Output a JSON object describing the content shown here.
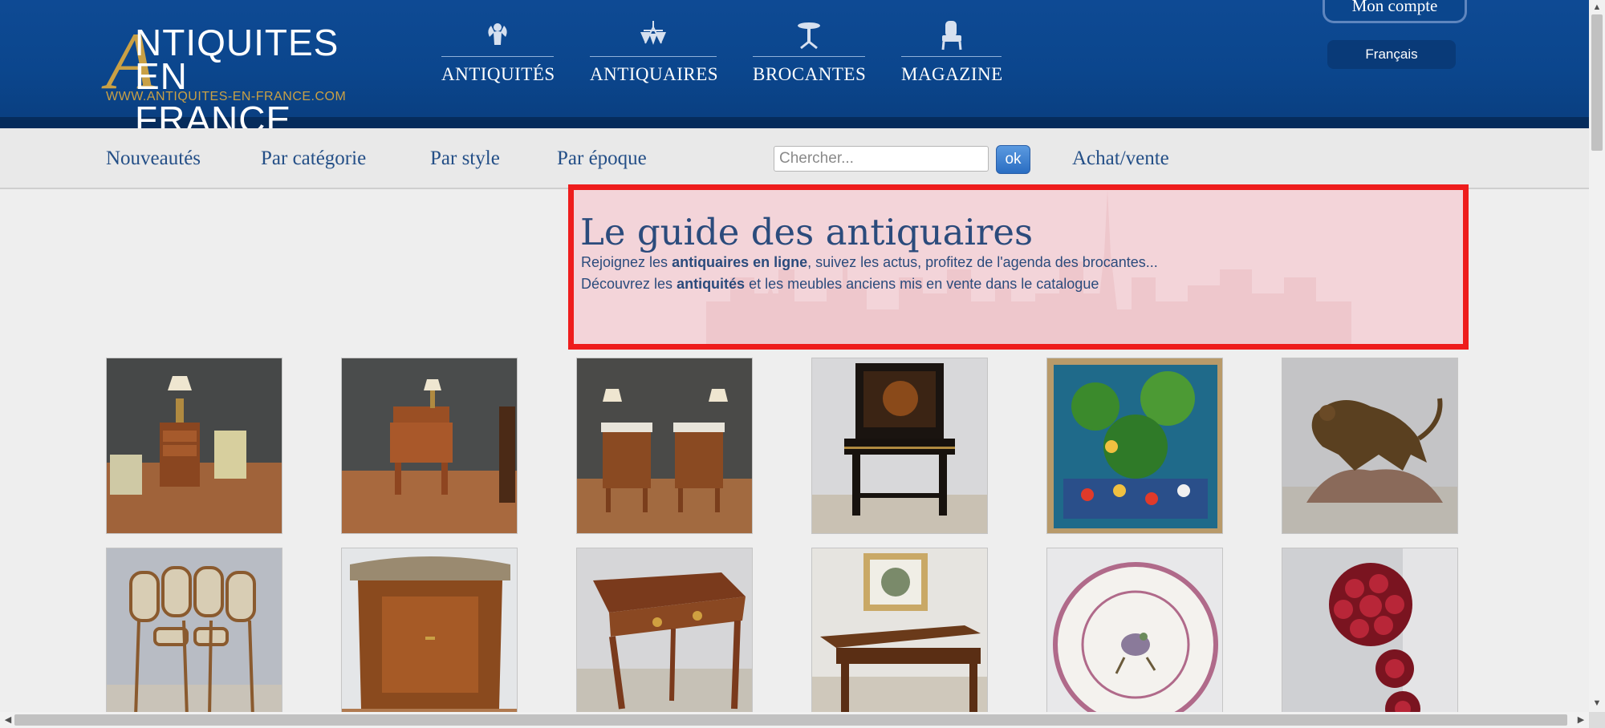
{
  "logo": {
    "letter": "A",
    "line1": "NTIQUITES",
    "line2": "EN FRANCE",
    "url": "WWW.ANTIQUITES-EN-FRANCE.COM"
  },
  "main_nav": [
    {
      "label": "ANTIQUITÉS",
      "icon": "cherub-icon"
    },
    {
      "label": "ANTIQUAIRES",
      "icon": "chandelier-icon"
    },
    {
      "label": "BROCANTES",
      "icon": "pedestal-table-icon"
    },
    {
      "label": "MAGAZINE",
      "icon": "armchair-icon"
    }
  ],
  "account": {
    "label": "Mon compte"
  },
  "language": {
    "label": "Français"
  },
  "subnav": {
    "links": [
      "Nouveautés",
      "Par catégorie",
      "Par style",
      "Par époque"
    ],
    "search_placeholder": "Chercher...",
    "search_button": "ok",
    "achat_vente": "Achat/vente"
  },
  "guide": {
    "title": "Le guide des antiquaires",
    "line1_a": "Rejoignez les ",
    "line1_b": "antiquaires en ligne",
    "line1_c": ", suivez les actus, profitez de l'agenda des brocantes...",
    "line2_a": "Découvrez les ",
    "line2_b": "antiquités",
    "line2_c": " et les meubles anciens mis en vente dans le catalogue"
  },
  "products": [
    {
      "name": "product-nightstand-chairs"
    },
    {
      "name": "product-writing-nightstand"
    },
    {
      "name": "product-pair-nightstands"
    },
    {
      "name": "product-napoleon-iii-desk"
    },
    {
      "name": "product-naive-painting"
    },
    {
      "name": "product-bronze-panther"
    },
    {
      "name": "product-bistro-chairs"
    },
    {
      "name": "product-demilune-commode"
    },
    {
      "name": "product-bureau-plat"
    },
    {
      "name": "product-farm-table"
    },
    {
      "name": "product-faience-plate"
    },
    {
      "name": "product-garnet-bracelet"
    }
  ],
  "colors": {
    "header_blue": "#0b468d",
    "gold": "#c9a045",
    "link_blue": "#244f87",
    "highlight_red": "#ee1c1c"
  }
}
